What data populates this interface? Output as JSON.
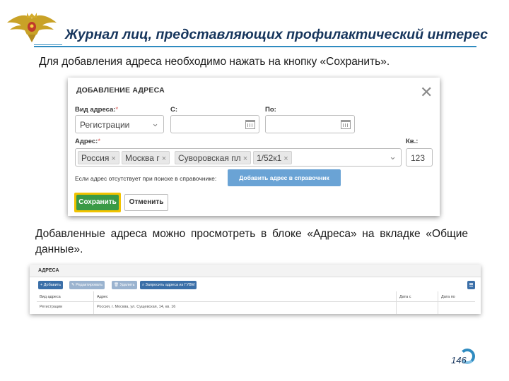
{
  "colors": {
    "accent": "#2f8bc0",
    "title": "#17365d",
    "save": "#3a9a46",
    "highlight": "#f2c300",
    "button_blue": "#6aa3d5",
    "toolbar_blue": "#3b6fa8"
  },
  "header": {
    "title": "Журнал лиц, представляющих профилактический интерес"
  },
  "text": {
    "para1": "Для добавления адреса необходимо нажать на кнопку «Сохранить».",
    "para2": "Добавленные адреса можно просмотреть в блоке «Адреса» на вкладке «Общие данные»."
  },
  "dialog": {
    "title": "ДОБАВЛЕНИЕ АДРЕСА",
    "close_icon": "close-icon",
    "type_label": "Вид адреса:",
    "type_value": "Регистрации",
    "from_label": "С:",
    "to_label": "По:",
    "address_label": "Адрес:",
    "required_mark": "*",
    "chips": [
      "Россия",
      "Москва г",
      "Суворовская пл",
      "1/52к1"
    ],
    "apt_label": "Кв.:",
    "apt_value": "123",
    "hint": "Если адрес отсутствует при поиске в справочнике:",
    "add_to_dir": "Добавить адрес в справочник",
    "save": "Сохранить",
    "cancel": "Отменить"
  },
  "addresses": {
    "title": "АДРЕСА",
    "toolbar": {
      "add": "Добавить",
      "edit": "Редактировать",
      "delete": "Удалить",
      "request": "Запросить адреса из ГУВМ"
    },
    "columns": [
      "Вид адреса",
      "Адрес",
      "Дата с",
      "Дата по"
    ],
    "rows": [
      {
        "type": "Регистрации",
        "address": "Россия, г. Москва, ул. Сущевская, 14, кв. 16",
        "from": "",
        "to": ""
      }
    ]
  },
  "page_number": "146"
}
